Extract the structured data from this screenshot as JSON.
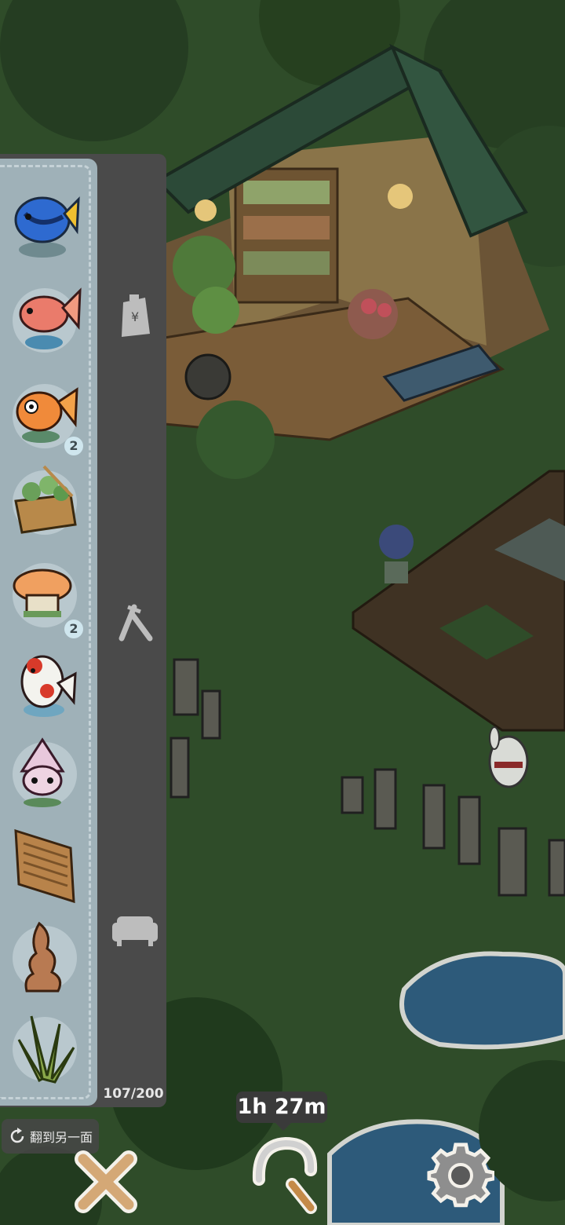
{
  "inventory": {
    "count": "107/200",
    "items": [
      {
        "icon": "blue-fish-icon",
        "badge": ""
      },
      {
        "icon": "red-fish-icon",
        "badge": ""
      },
      {
        "icon": "goldfish-icon",
        "badge": "2"
      },
      {
        "icon": "plant-basket-icon",
        "badge": ""
      },
      {
        "icon": "mushroom-stool-icon",
        "badge": "2"
      },
      {
        "icon": "koi-fish-icon",
        "badge": ""
      },
      {
        "icon": "squid-icon",
        "badge": ""
      },
      {
        "icon": "wooden-screen-icon",
        "badge": ""
      },
      {
        "icon": "rock-statue-icon",
        "badge": ""
      },
      {
        "icon": "succulent-plant-icon",
        "badge": ""
      }
    ]
  },
  "categories": [
    {
      "name": "shop-bag-icon"
    },
    {
      "name": "tools-icon"
    },
    {
      "name": "furniture-sofa-icon"
    }
  ],
  "flip_label": "翻到另一面",
  "timer": "1h 27m",
  "controls": {
    "close": "close-icon",
    "sickle": "sickle-icon",
    "settings": "gear-icon"
  },
  "colors": {
    "panel": "#4a4a4a",
    "tray": "#9fb1b8",
    "grass": "#2f4e2a"
  }
}
